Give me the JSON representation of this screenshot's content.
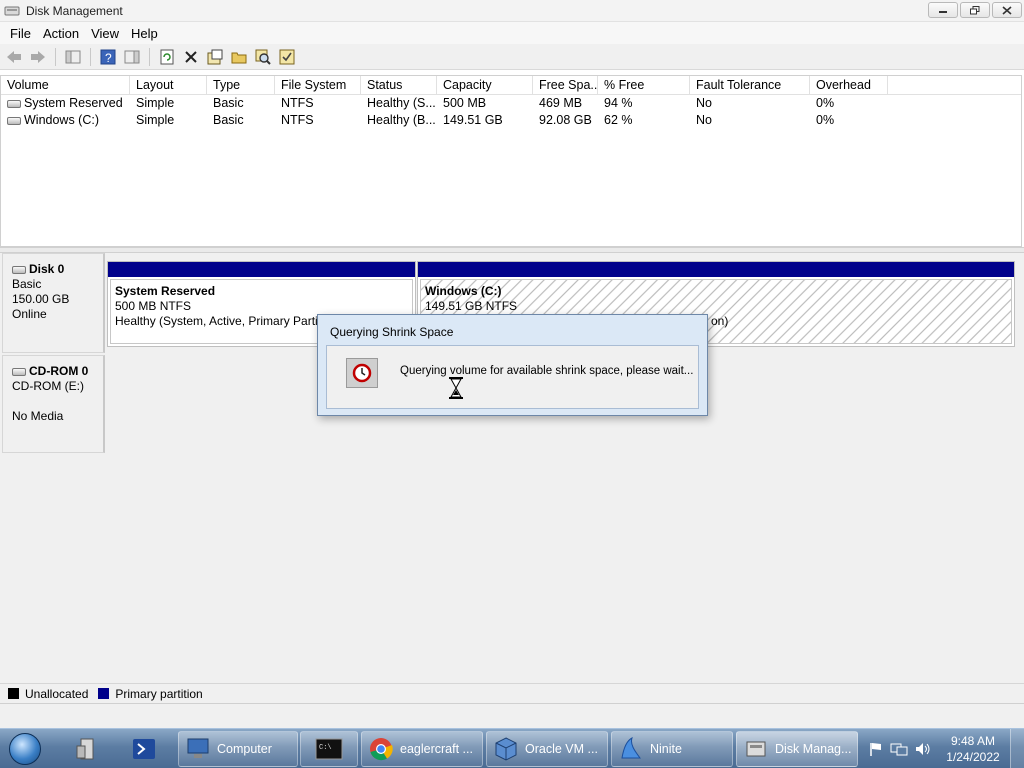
{
  "window": {
    "title": "Disk Management"
  },
  "menu": [
    "File",
    "Action",
    "View",
    "Help"
  ],
  "volume_list": {
    "columns": [
      "Volume",
      "Layout",
      "Type",
      "File System",
      "Status",
      "Capacity",
      "Free Spa...",
      "% Free",
      "Fault Tolerance",
      "Overhead"
    ],
    "rows": [
      [
        "System Reserved",
        "Simple",
        "Basic",
        "NTFS",
        "Healthy (S...",
        "500 MB",
        "469 MB",
        "94 %",
        "No",
        "0%"
      ],
      [
        "Windows (C:)",
        "Simple",
        "Basic",
        "NTFS",
        "Healthy (B...",
        "149.51 GB",
        "92.08 GB",
        "62 %",
        "No",
        "0%"
      ]
    ]
  },
  "disks": {
    "disk0": {
      "name": "Disk 0",
      "type": "Basic",
      "size": "150.00 GB",
      "status": "Online"
    },
    "cdrom0": {
      "name": "CD-ROM 0",
      "drive": "CD-ROM (E:)",
      "media": "No Media"
    }
  },
  "partitions": {
    "system_reserved": {
      "name": "System Reserved",
      "size": "500 MB NTFS",
      "status": "Healthy (System, Active, Primary Partiti"
    },
    "windows": {
      "name": "Windows  (C:)",
      "size": "149.51 GB NTFS",
      "status_tail": "on)"
    }
  },
  "legend": {
    "unallocated": "Unallocated",
    "primary": "Primary partition",
    "unallocated_color": "#000000",
    "primary_color": "#00008b"
  },
  "dialog": {
    "title": "Querying Shrink Space",
    "message": "Querying volume for available shrink space, please wait..."
  },
  "taskbar": {
    "buttons": {
      "computer": "Computer",
      "chrome": "eaglercraft ...",
      "virtualbox": "Oracle VM ...",
      "ninite": "Ninite",
      "diskmgmt": "Disk Manag..."
    },
    "clock": {
      "time": "9:48 AM",
      "date": "1/24/2022"
    }
  }
}
